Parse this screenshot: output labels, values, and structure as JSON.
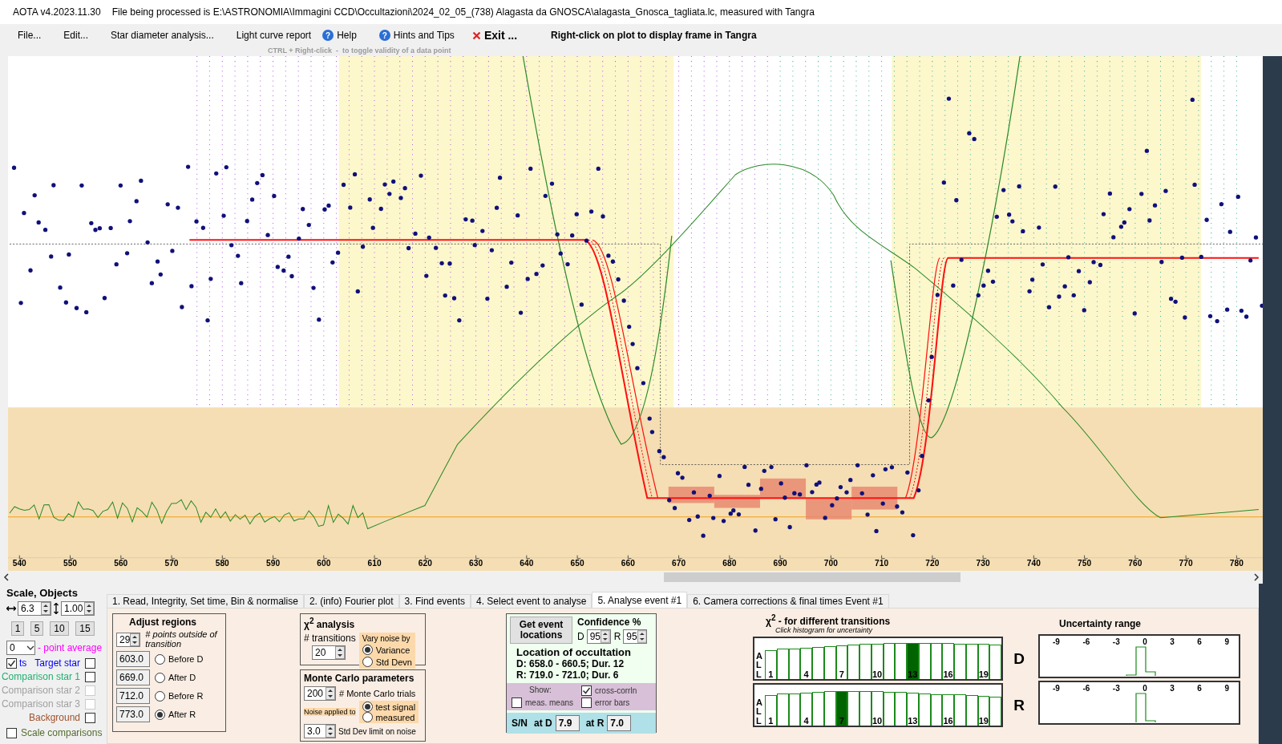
{
  "window": {
    "app": "AOTA v4.2023.11.30",
    "file_info": "File being processed is E:\\ASTRONOMIA\\Immagini CCD\\Occultazioni\\2024_02_05_(738) Alagasta da GNOSCA\\alagasta_Gnosca_tagliata.lc, measured with Tangra"
  },
  "menu": [
    {
      "label": "File...",
      "kind": "plain"
    },
    {
      "label": "Edit...",
      "kind": "plain"
    },
    {
      "label": "Star diameter analysis...",
      "kind": "plain"
    },
    {
      "label": "Light curve report",
      "kind": "plain"
    },
    {
      "label": "Help",
      "kind": "help",
      "icon": "?"
    },
    {
      "label": "Hints and Tips",
      "kind": "help",
      "icon": "?"
    },
    {
      "label": "Exit ...",
      "kind": "exit"
    }
  ],
  "plot_hint": "Right-click on plot to display frame in Tangra",
  "plot_subhint": "CTRL + Right-click  -  to toggle validity of a data point",
  "plot": {
    "x_tick_labels": [
      "540",
      "550",
      "560",
      "570",
      "580",
      "590",
      "600",
      "610",
      "620",
      "630",
      "640",
      "650",
      "660",
      "670",
      "680",
      "690",
      "700",
      "710",
      "720",
      "730",
      "740",
      "750",
      "760",
      "770",
      "780"
    ]
  },
  "scale": {
    "title": "Scale,  Objects",
    "horizontal": "6.3",
    "vertical": "1.00",
    "buttons": [
      "1",
      "5",
      "10",
      "15"
    ],
    "point_average": {
      "value": "0",
      "label": "- point average"
    },
    "show_points": {
      "label": "ts",
      "checked": true
    },
    "objects": [
      {
        "label": "Target star",
        "color": "#0000ff",
        "checked": false,
        "disabled": false
      },
      {
        "label": "Comparison star 1",
        "color": "#20b070",
        "checked": false,
        "disabled": false
      },
      {
        "label": "Comparison star 2",
        "color": "#a0a0a0",
        "checked": false,
        "disabled": true
      },
      {
        "label": "Comparison star 3",
        "color": "#a0a0a0",
        "checked": false,
        "disabled": true
      },
      {
        "label": "Background",
        "color": "#a0522d",
        "checked": false,
        "disabled": false
      }
    ],
    "scale_comparisons": {
      "label": "Scale comparisons",
      "checked": false
    }
  },
  "tabs": [
    {
      "label": "1.  Read, Integrity, Set time, Bin & normalise",
      "selected": false
    },
    {
      "label": "2. (info)  Fourier plot",
      "selected": false
    },
    {
      "label": "3. Find events",
      "selected": false
    },
    {
      "label": "4. Select event to analyse",
      "selected": false
    },
    {
      "label": "5. Analyse event #1",
      "selected": true
    },
    {
      "label": "6. Camera corrections & final times Event #1",
      "selected": false
    }
  ],
  "adjust_regions": {
    "title": "Adjust regions",
    "points": "29",
    "points_label": "# points outside of transition",
    "regions": [
      {
        "value": "603.0",
        "label": "Before D",
        "selected": false
      },
      {
        "value": "669.0",
        "label": "After D",
        "selected": false
      },
      {
        "value": "712.0",
        "label": "Before R",
        "selected": false
      },
      {
        "value": "773.0",
        "label": "After R",
        "selected": true
      }
    ]
  },
  "chi2_analysis": {
    "title": "χ$^{2}$ analysis",
    "transitions_label": "# transitions",
    "transitions": "20",
    "vary_title": "Vary noise by",
    "vary": [
      {
        "label": "Variance",
        "selected": true
      },
      {
        "label": "Std Devn",
        "selected": false
      }
    ]
  },
  "monte_carlo": {
    "title": "Monte Carlo parameters",
    "trials": "200",
    "trials_label": "# Monte Carlo trials",
    "noise_label": "Noise applied to",
    "noise": [
      {
        "label": "test signal",
        "selected": true
      },
      {
        "label": "measured",
        "selected": false
      }
    ],
    "std_limit": "3.0",
    "std_limit_label": "Std Dev limit on noise"
  },
  "location": {
    "button": "Get event locations",
    "confidence_title": "Confidence %",
    "confidence": [
      {
        "label": "D",
        "value": "95"
      },
      {
        "label": "R",
        "value": "95"
      }
    ],
    "title": "Location of occultation",
    "lines": [
      "D: 658.0 - 660.5; Dur. 12",
      "R: 719.0 - 721.0; Dur. 6"
    ],
    "show_label": "Show:",
    "options": [
      {
        "label": "cross-corrln",
        "checked": true
      },
      {
        "label": "meas. means",
        "checked": false
      },
      {
        "label": "error bars",
        "checked": false
      }
    ],
    "sn_label": "S/N",
    "sn": [
      {
        "label": "at D",
        "value": "7.9"
      },
      {
        "label": "at R",
        "value": "7.0"
      }
    ]
  },
  "transitions": {
    "title": "χ$^{2}$ - for different transitions",
    "subtitle": "Click histogram for uncertainty",
    "histograms": [
      {
        "event": "D",
        "side_label": "ALL",
        "bars": [
          {
            "label": "1",
            "selected": false
          },
          {
            "selected": false
          },
          {
            "selected": false
          },
          {
            "label": "4",
            "selected": false
          },
          {
            "selected": false
          },
          {
            "selected": false
          },
          {
            "label": "7",
            "selected": false
          },
          {
            "selected": false
          },
          {
            "selected": false
          },
          {
            "label": "10",
            "selected": false
          },
          {
            "selected": false
          },
          {
            "selected": false
          },
          {
            "label": "13",
            "selected": true
          },
          {
            "selected": false
          },
          {
            "selected": false
          },
          {
            "label": "16",
            "selected": false
          },
          {
            "selected": false
          },
          {
            "selected": false
          },
          {
            "label": "19",
            "selected": false
          },
          {
            "selected": false
          }
        ]
      },
      {
        "event": "R",
        "side_label": "ALL",
        "bars": [
          {
            "label": "1",
            "selected": false
          },
          {
            "selected": false
          },
          {
            "selected": false
          },
          {
            "label": "4",
            "selected": false
          },
          {
            "selected": false
          },
          {
            "selected": false
          },
          {
            "label": "7",
            "selected": true
          },
          {
            "selected": false
          },
          {
            "selected": false
          },
          {
            "label": "10",
            "selected": false
          },
          {
            "selected": false
          },
          {
            "selected": false
          },
          {
            "label": "13",
            "selected": false
          },
          {
            "selected": false
          },
          {
            "selected": false
          },
          {
            "label": "16",
            "selected": false
          },
          {
            "selected": false
          },
          {
            "selected": false
          },
          {
            "label": "19",
            "selected": false
          },
          {
            "selected": false
          }
        ]
      }
    ]
  },
  "uncertainty": {
    "title": "Uncertainty range",
    "plots": [
      {
        "ticks": [
          "-9",
          "-6",
          "-3",
          "0",
          "3",
          "6",
          "9"
        ]
      },
      {
        "ticks": [
          "-9",
          "-6",
          "-3",
          "0",
          "3",
          "6",
          "9"
        ]
      }
    ]
  }
}
